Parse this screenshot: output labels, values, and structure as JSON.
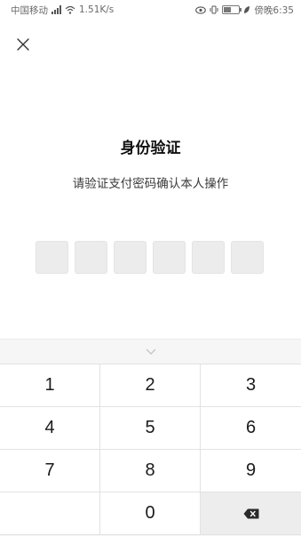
{
  "status_bar": {
    "carrier": "中国移动",
    "network_speed": "1.51K/s",
    "time": "傍晚6:35",
    "battery_level": "40"
  },
  "dialog": {
    "title": "身份验证",
    "subtitle": "请验证支付密码确认本人操作",
    "pin_length": 6
  },
  "keypad": {
    "rows": [
      [
        "1",
        "2",
        "3"
      ],
      [
        "4",
        "5",
        "6"
      ],
      [
        "7",
        "8",
        "9"
      ],
      [
        "",
        "0",
        "⌫"
      ]
    ]
  },
  "colors": {
    "pin_box": "#ececec",
    "keyboard_bg": "#f6f6f6",
    "delete_key_bg": "#ededed"
  }
}
